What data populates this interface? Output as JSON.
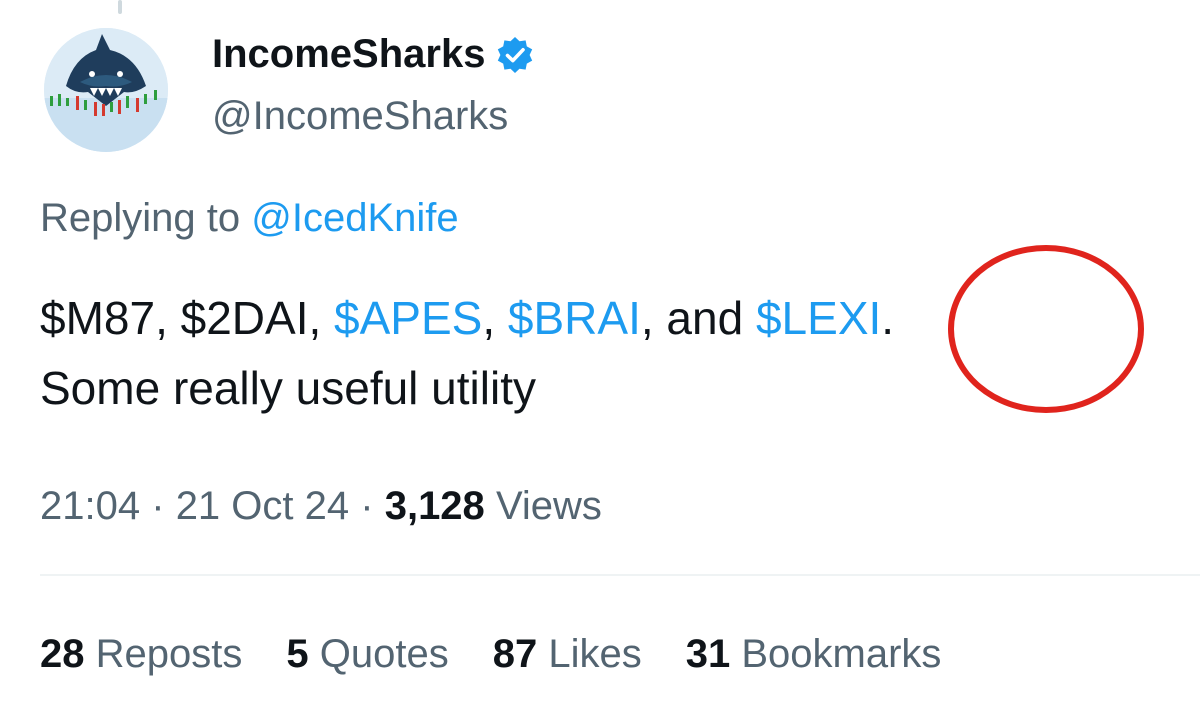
{
  "author": {
    "display_name": "IncomeSharks",
    "handle": "@IncomeSharks",
    "verified": true
  },
  "replying_to": {
    "prefix": "Replying to ",
    "handle": "@IcedKnife"
  },
  "tweet": {
    "line1": [
      {
        "text": "$M87, $2DAI, ",
        "kind": "plain"
      },
      {
        "text": "$APES",
        "kind": "cashtag"
      },
      {
        "text": ", ",
        "kind": "plain"
      },
      {
        "text": "$BRAI",
        "kind": "cashtag"
      },
      {
        "text": ", and ",
        "kind": "plain"
      },
      {
        "text": "$LEXI",
        "kind": "cashtag"
      },
      {
        "text": ".",
        "kind": "plain"
      }
    ],
    "line2": "Some really useful utility"
  },
  "meta": {
    "time": "21:04",
    "date": "21 Oct 24",
    "views_count": "3,128",
    "views_label": "Views",
    "separator": "·"
  },
  "stats": [
    {
      "count": "28",
      "label": "Reposts"
    },
    {
      "count": "5",
      "label": "Quotes"
    },
    {
      "count": "87",
      "label": "Likes"
    },
    {
      "count": "31",
      "label": "Bookmarks"
    }
  ],
  "colors": {
    "link": "#1d9bf0",
    "circle_annotation": "#e0241d",
    "secondary_text": "#536471"
  },
  "icons": {
    "verified": "verified-badge-icon"
  }
}
